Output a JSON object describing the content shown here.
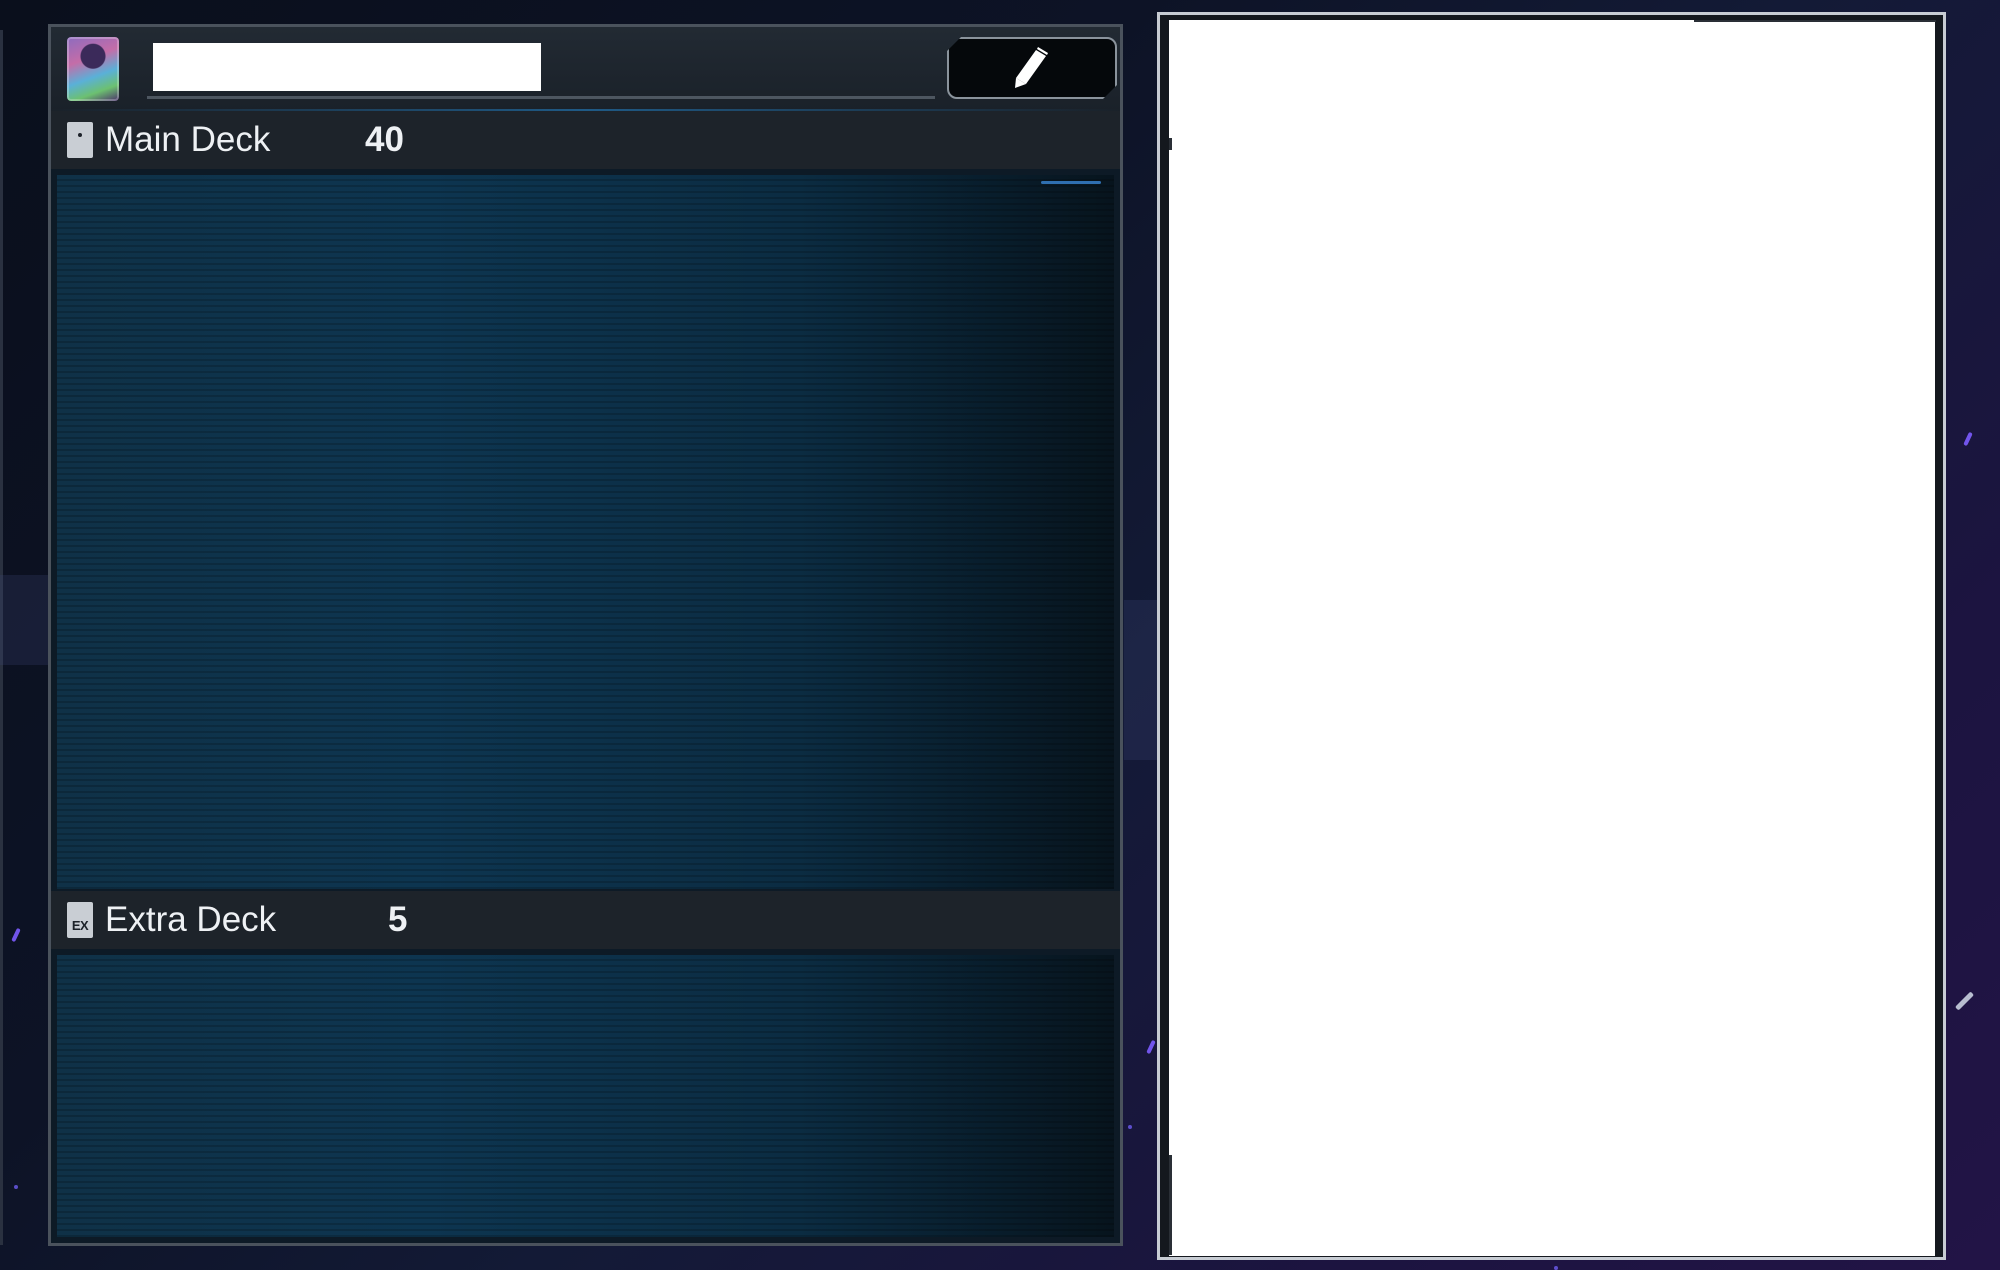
{
  "deck": {
    "name": "",
    "sections": [
      {
        "label": "Main Deck",
        "count": "40"
      },
      {
        "label": "Extra Deck",
        "count": "5"
      }
    ]
  },
  "icons": {
    "deck_box": "deck-box-icon",
    "edit": "pencil-icon",
    "main_deck": "main-deck-icon",
    "extra_deck": "extra-deck-icon"
  },
  "colors": {
    "card_area": "#0d3550",
    "section_bar": "#1d232a",
    "preview_background": "#ffffff"
  }
}
